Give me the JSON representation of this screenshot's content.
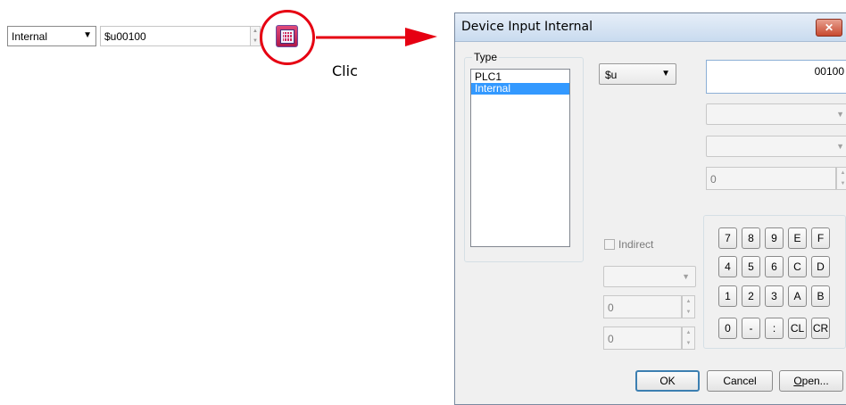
{
  "source_control": {
    "type_value": "Internal",
    "address_value": "$u00100"
  },
  "annotation": {
    "label": "Clic",
    "highlight_color": "#e60012"
  },
  "dialog": {
    "title": "Device Input  Internal",
    "close_glyph": "✕",
    "type_group_label": "Type",
    "type_list": [
      "PLC1",
      "Internal"
    ],
    "selected_type": "Internal",
    "device_prefix": "$u",
    "address_value": "00100",
    "offset_value": "0",
    "indirect_label": "Indirect",
    "indirect_checked": false,
    "indirect_value_1": "0",
    "indirect_value_2": "0",
    "keypad_rows": [
      [
        "7",
        "8",
        "9",
        "E",
        "F"
      ],
      [
        "4",
        "5",
        "6",
        "C",
        "D"
      ],
      [
        "1",
        "2",
        "3",
        "A",
        "B"
      ],
      [
        "0",
        "-",
        ":",
        "CL",
        "CR"
      ]
    ],
    "buttons": {
      "ok": "OK",
      "cancel": "Cancel",
      "open_mnemonic": "O",
      "open_rest": "pen..."
    }
  }
}
